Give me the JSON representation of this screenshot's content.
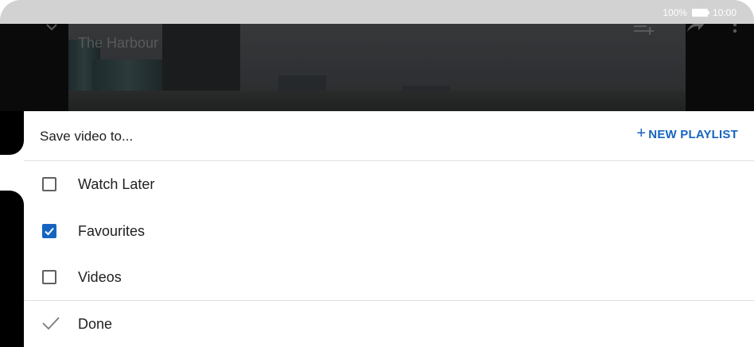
{
  "status_bar": {
    "battery_percent": "100%",
    "time": "10:00"
  },
  "video": {
    "title": "The Harbour"
  },
  "sheet": {
    "title": "Save video to...",
    "new_playlist_label": "NEW PLAYLIST",
    "playlists": [
      {
        "label": "Watch Later",
        "checked": false
      },
      {
        "label": "Favourites",
        "checked": true
      },
      {
        "label": "Videos",
        "checked": false
      }
    ],
    "done_label": "Done"
  },
  "colors": {
    "accent": "#1565c0",
    "text": "#202020",
    "divider": "#e0e0e0"
  },
  "icons": {
    "back": "chevron-down-icon",
    "add_to_queue": "add-to-queue-icon",
    "share": "share-icon",
    "more": "more-vert-icon",
    "plus": "plus-icon",
    "check": "check-icon"
  }
}
